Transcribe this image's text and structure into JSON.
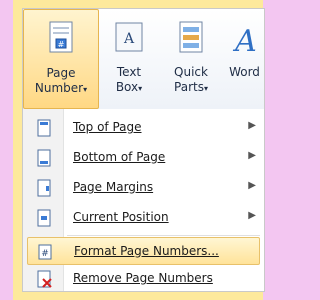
{
  "ribbon": {
    "page_number": {
      "line1": "Page",
      "line2": "Number",
      "arrow": "▾",
      "icon": "page-number-icon"
    },
    "text_box": {
      "line1": "Text",
      "line2": "Box",
      "arrow": "▾",
      "icon": "text-box-icon"
    },
    "quick_parts": {
      "line1": "Quick",
      "line2": "Parts",
      "arrow": "▾",
      "icon": "quick-parts-icon"
    },
    "wordart": {
      "line1": "Word",
      "icon": "wordart-icon"
    }
  },
  "menu": {
    "items": [
      {
        "label": "Top of Page",
        "submenu": "▶",
        "icon": "page-top-icon"
      },
      {
        "label": "Bottom of Page",
        "submenu": "▶",
        "icon": "page-bottom-icon"
      },
      {
        "label": "Page Margins",
        "submenu": "▶",
        "icon": "page-margins-icon"
      },
      {
        "label": "Current Position",
        "submenu": "▶",
        "icon": "current-position-icon"
      },
      {
        "label": "Format Page Numbers...",
        "icon": "format-page-numbers-icon"
      },
      {
        "label": "Remove Page Numbers",
        "icon": "remove-page-numbers-icon"
      }
    ]
  }
}
